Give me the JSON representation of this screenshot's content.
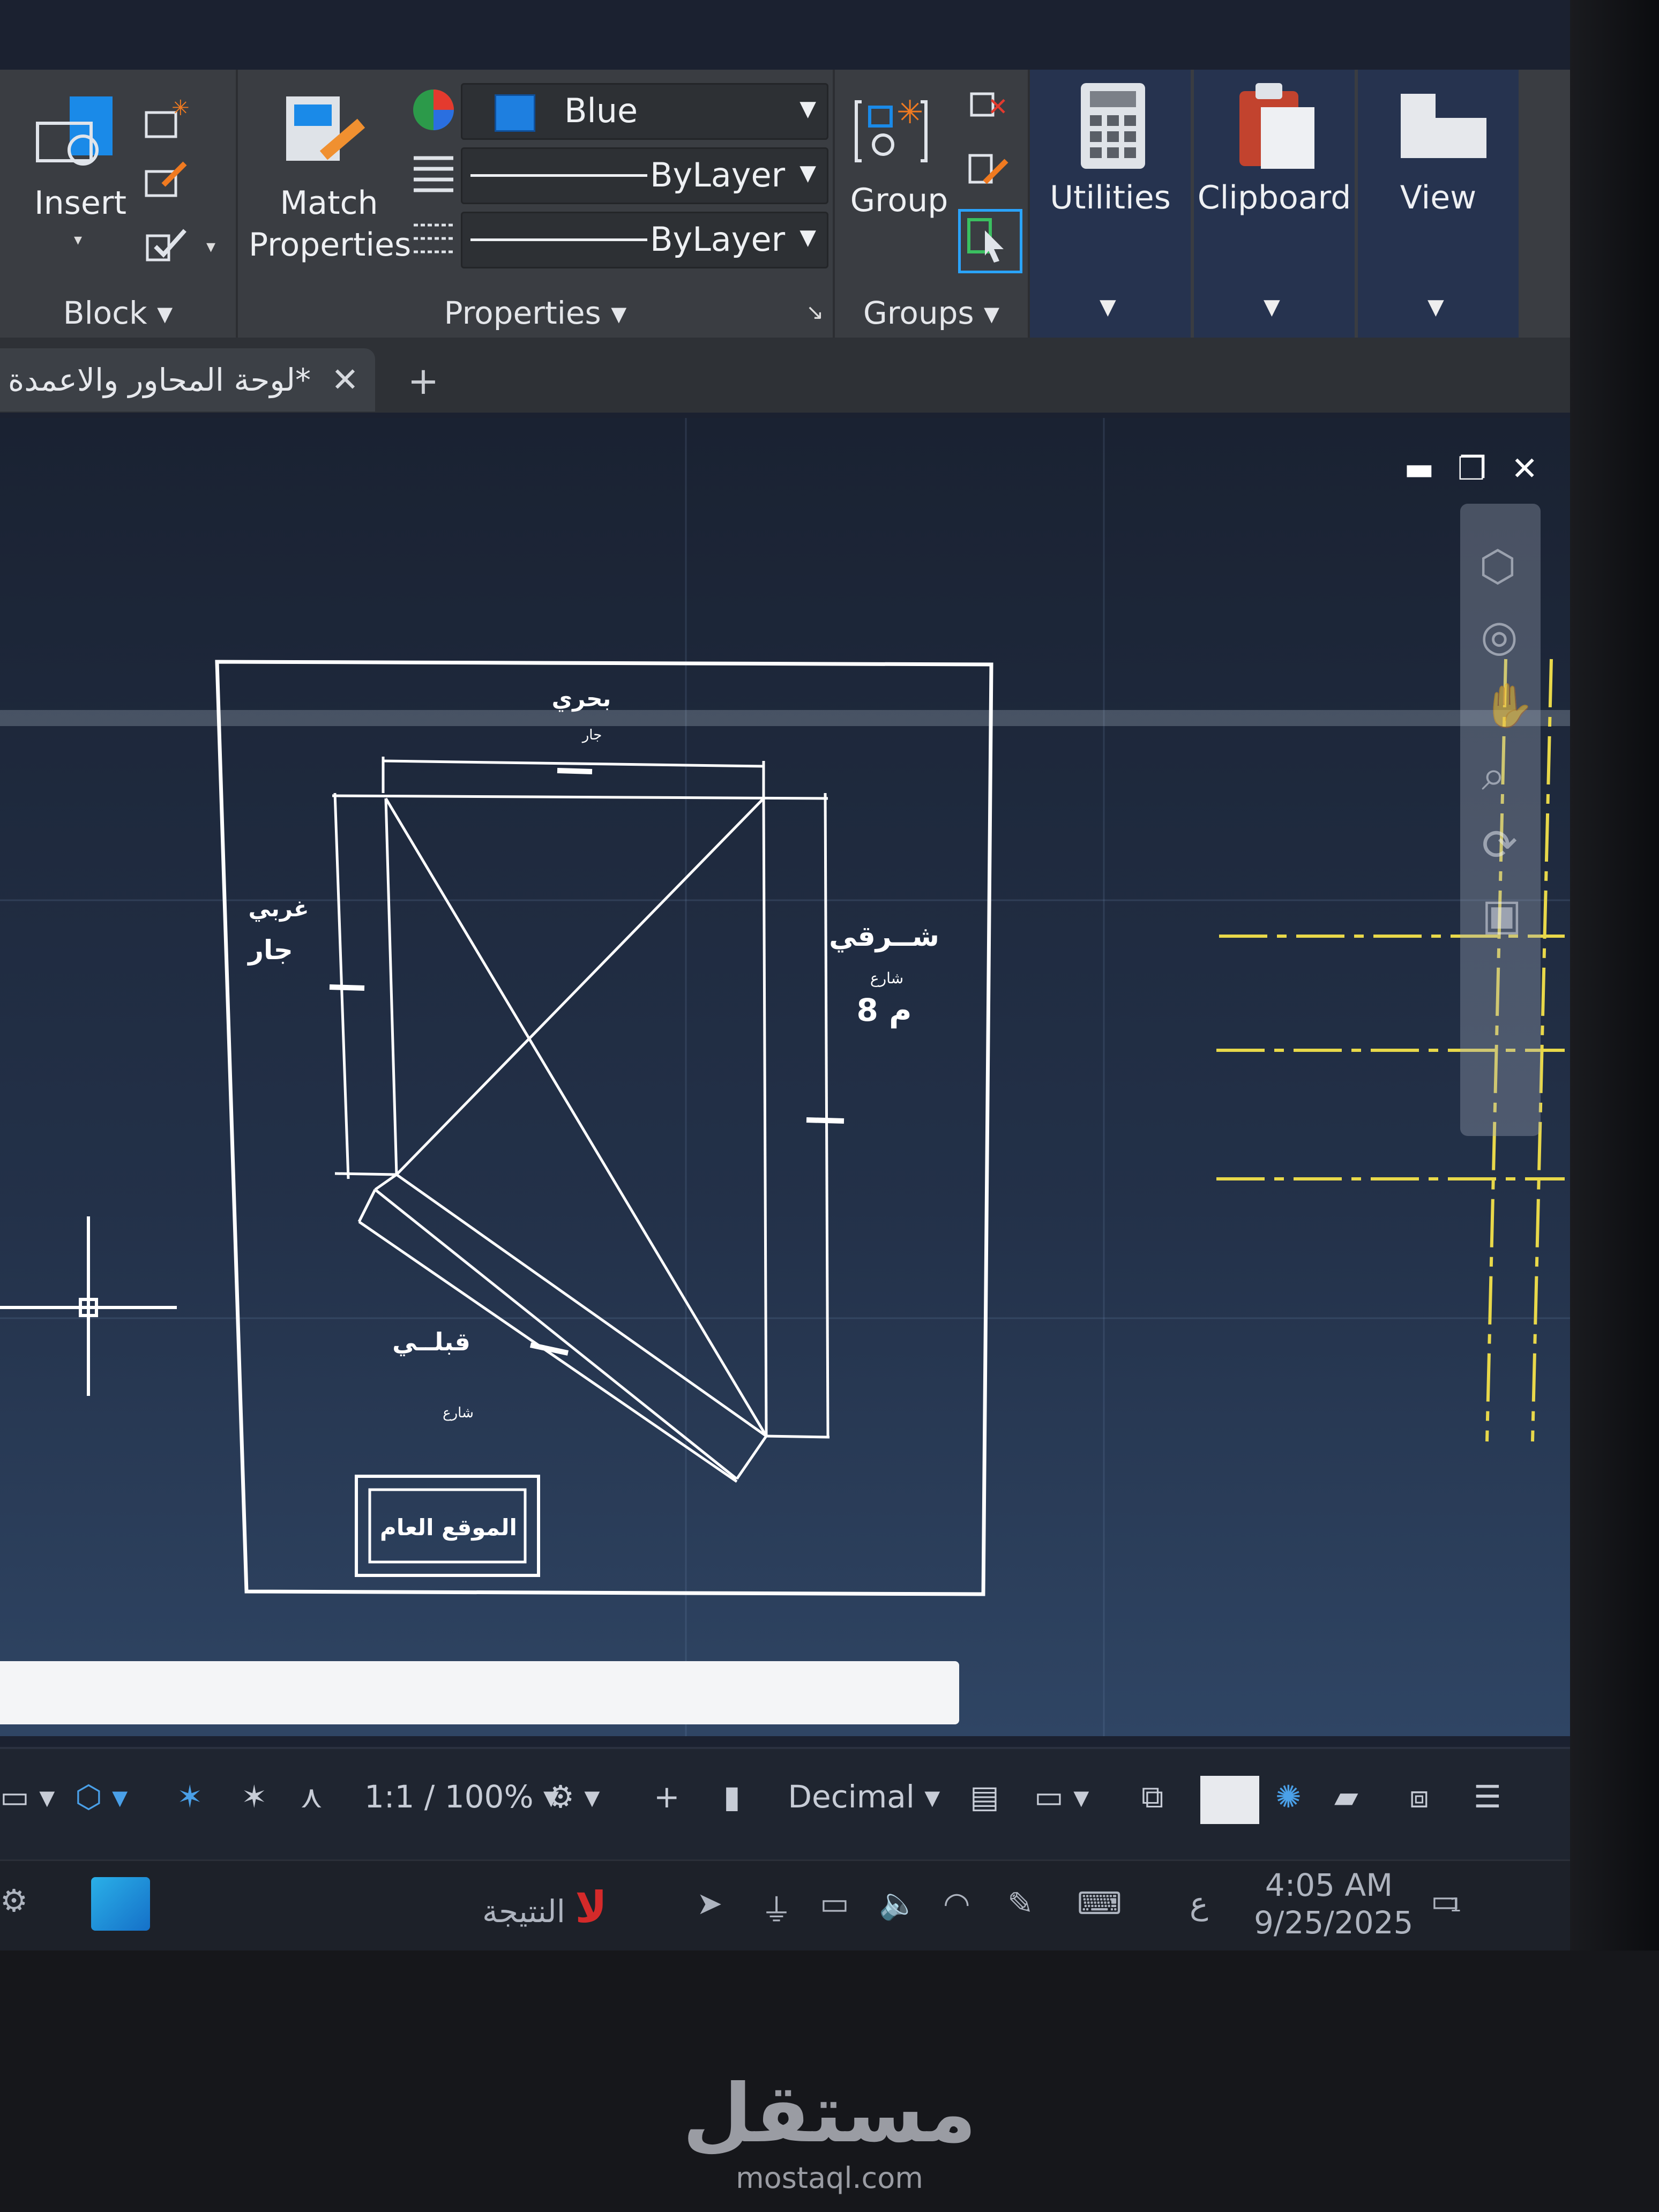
{
  "ribbon": {
    "block": {
      "insert_label": "Insert",
      "title": "Block"
    },
    "match_properties": {
      "line1": "Match",
      "line2": "Properties"
    },
    "properties": {
      "title": "Properties",
      "color_value": "Blue",
      "color_swatch": "#1e7fe0",
      "linetype_value": "ByLayer",
      "lineweight_value": "ByLayer"
    },
    "groups": {
      "group_label": "Group",
      "title": "Groups"
    },
    "utilities_label": "Utilities",
    "clipboard_label": "Clipboard",
    "view_label": "View"
  },
  "tabs": {
    "active_tab": "لوحة المحاور والاعمدة*",
    "add_icon": "plus-icon",
    "close_icon": "close-icon"
  },
  "drawing": {
    "north": "بحري",
    "north_sub": "جار",
    "west": "غربي",
    "west_sub": "جار",
    "east": "شــرقي",
    "east_sub": "شارع",
    "east_width": "8 م",
    "south": "قبلــي",
    "south_sub": "شارع",
    "title_block": "الموقع العام",
    "line_color": "#ffffff",
    "axis_color": "#e8d84a"
  },
  "statusbar": {
    "scale": "1:1 / 100%",
    "units": "Decimal"
  },
  "taskbar": {
    "app_label": "النتيجة",
    "language": "ع",
    "time": "4:05 AM",
    "date": "9/25/2025",
    "notifications": "1"
  },
  "watermark": {
    "main": "مستقل",
    "sub": "mostaql.com"
  }
}
